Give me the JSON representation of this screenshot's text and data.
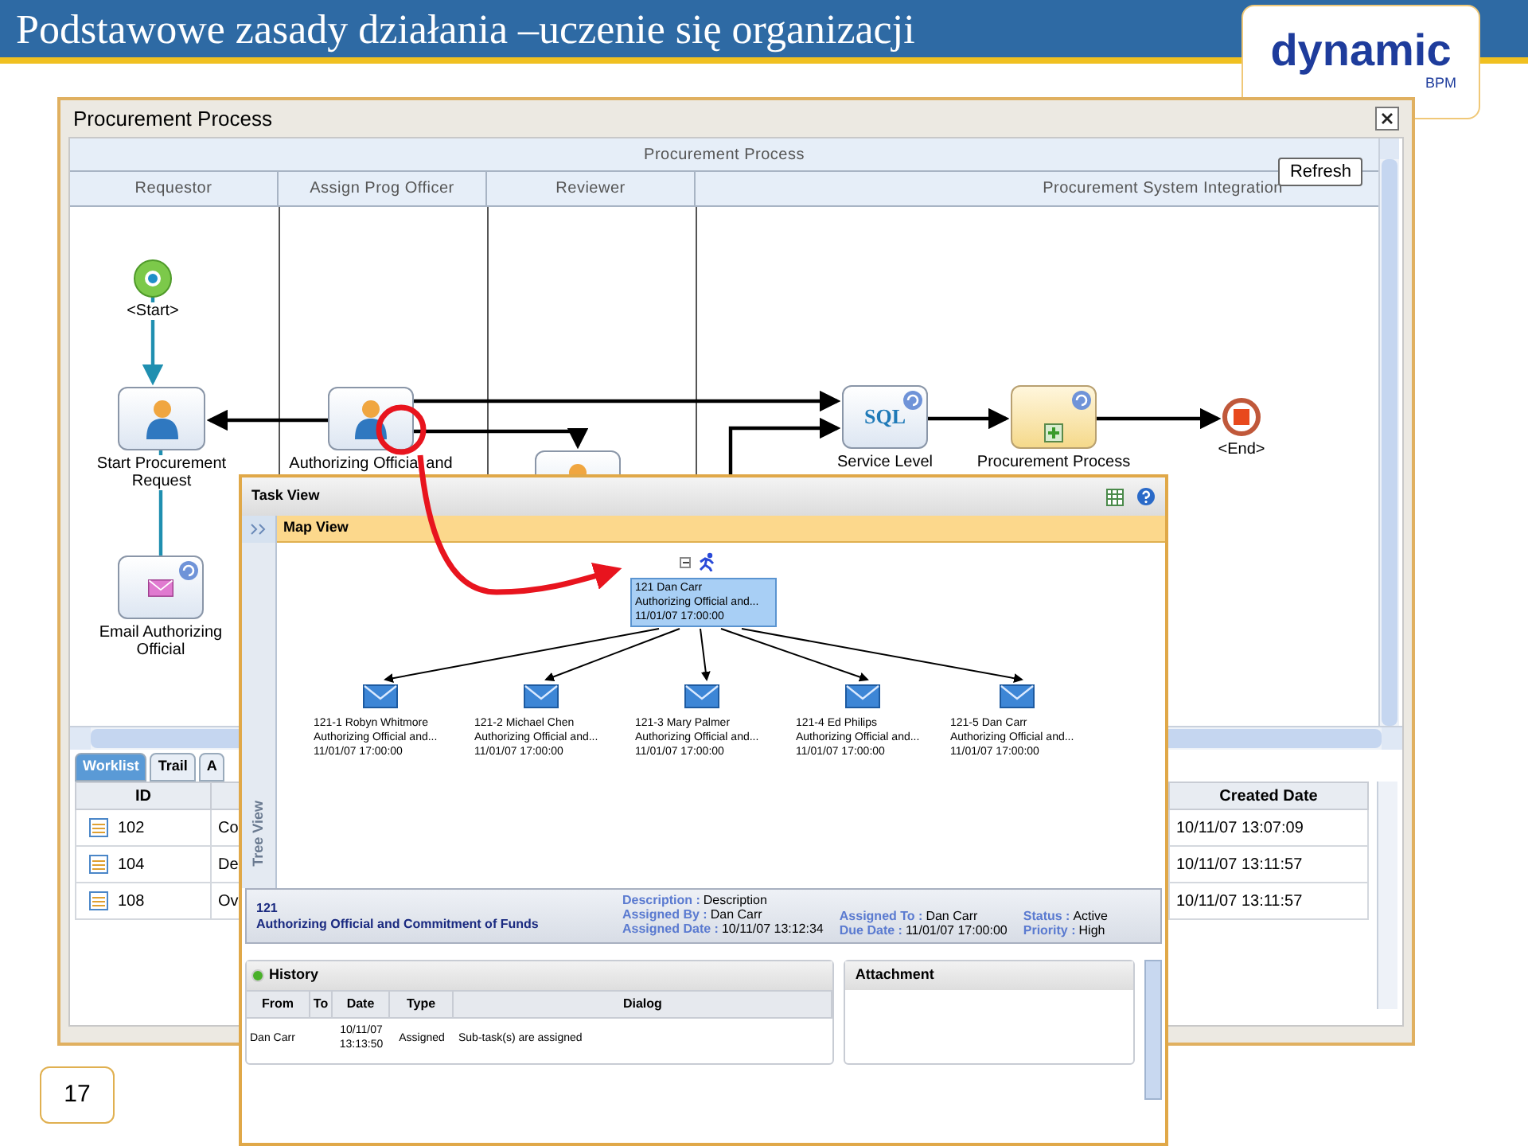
{
  "slide": {
    "title": "Podstawowe zasady działania –uczenie się organizacji",
    "logo": {
      "name": "dynamic",
      "sub": "BPM"
    },
    "page_number": "17"
  },
  "process_window": {
    "title": "Procurement Process",
    "pool": "Procurement Process",
    "refresh": "Refresh",
    "lanes": [
      "Requestor",
      "Assign Prog Officer",
      "Reviewer",
      "Procurement System Integration"
    ],
    "nodes": [
      {
        "kind": "start",
        "label": "<Start>"
      },
      {
        "kind": "user",
        "label": "Start Procurement Request"
      },
      {
        "kind": "user",
        "label": "Authorizing Official and"
      },
      {
        "kind": "user"
      },
      {
        "kind": "email",
        "label": "Email Authorizing Official"
      },
      {
        "kind": "sql",
        "icon_text": "SQL",
        "label": "Service Level"
      },
      {
        "kind": "subprocess",
        "label": "Procurement Process"
      },
      {
        "kind": "end",
        "label": "<End>"
      }
    ],
    "worklist": {
      "tabs": [
        {
          "label": "Worklist",
          "selected": true
        },
        {
          "label": "Trail",
          "selected": false
        },
        {
          "label": "A",
          "selected": false
        }
      ],
      "columns": [
        "ID",
        "Created Date"
      ],
      "rows": [
        {
          "id": "102",
          "column_2": "Co",
          "created": "10/11/07 13:07:09"
        },
        {
          "id": "104",
          "column_2": "De",
          "created": "10/11/07 13:11:57"
        },
        {
          "id": "108",
          "column_2": "Ov",
          "created": "10/11/07 13:11:57"
        }
      ]
    }
  },
  "task_view": {
    "title": "Task View",
    "map_view": "Map View",
    "tree_view": "Tree View",
    "root": [
      "121 Dan Carr",
      "Authorizing Official and...",
      "11/01/07 17:00:00"
    ],
    "children": [
      {
        "lines": [
          "121-1 Robyn Whitmore",
          "Authorizing Official and...",
          "11/01/07 17:00:00"
        ]
      },
      {
        "lines": [
          "121-2 Michael Chen",
          "Authorizing Official and...",
          "11/01/07 17:00:00"
        ]
      },
      {
        "lines": [
          "121-3 Mary Palmer",
          "Authorizing Official and...",
          "11/01/07 17:00:00"
        ]
      },
      {
        "lines": [
          "121-4 Ed Philips",
          "Authorizing Official and...",
          "11/01/07 17:00:00"
        ]
      },
      {
        "lines": [
          "121-5 Dan Carr",
          "Authorizing Official and...",
          "11/01/07 17:00:00"
        ]
      }
    ],
    "task": {
      "id": "121",
      "name": "Authorizing Official and Commitment of Funds",
      "detail_columns": [
        [
          {
            "label": "Description :",
            "value": "Description"
          },
          {
            "label": "Assigned By :",
            "value": "Dan Carr"
          },
          {
            "label": "Assigned Date :",
            "value": "10/11/07 13:12:34"
          }
        ],
        [
          {
            "label": "Assigned To :",
            "value": "Dan Carr"
          },
          {
            "label": "Due Date :",
            "value": "11/01/07 17:00:00"
          }
        ],
        [
          {
            "label": "Status :",
            "value": "Active"
          },
          {
            "label": "Priority :",
            "value": "High"
          }
        ]
      ]
    },
    "history": {
      "title": "History",
      "columns": [
        "From",
        "To",
        "Date",
        "Type",
        "Dialog"
      ],
      "rows": [
        {
          "from": "Dan Carr",
          "date": "10/11/07 13:13:50",
          "type": "Assigned",
          "dialog": "Sub-task(s) are assigned"
        }
      ]
    },
    "attachment": {
      "title": "Attachment"
    }
  }
}
